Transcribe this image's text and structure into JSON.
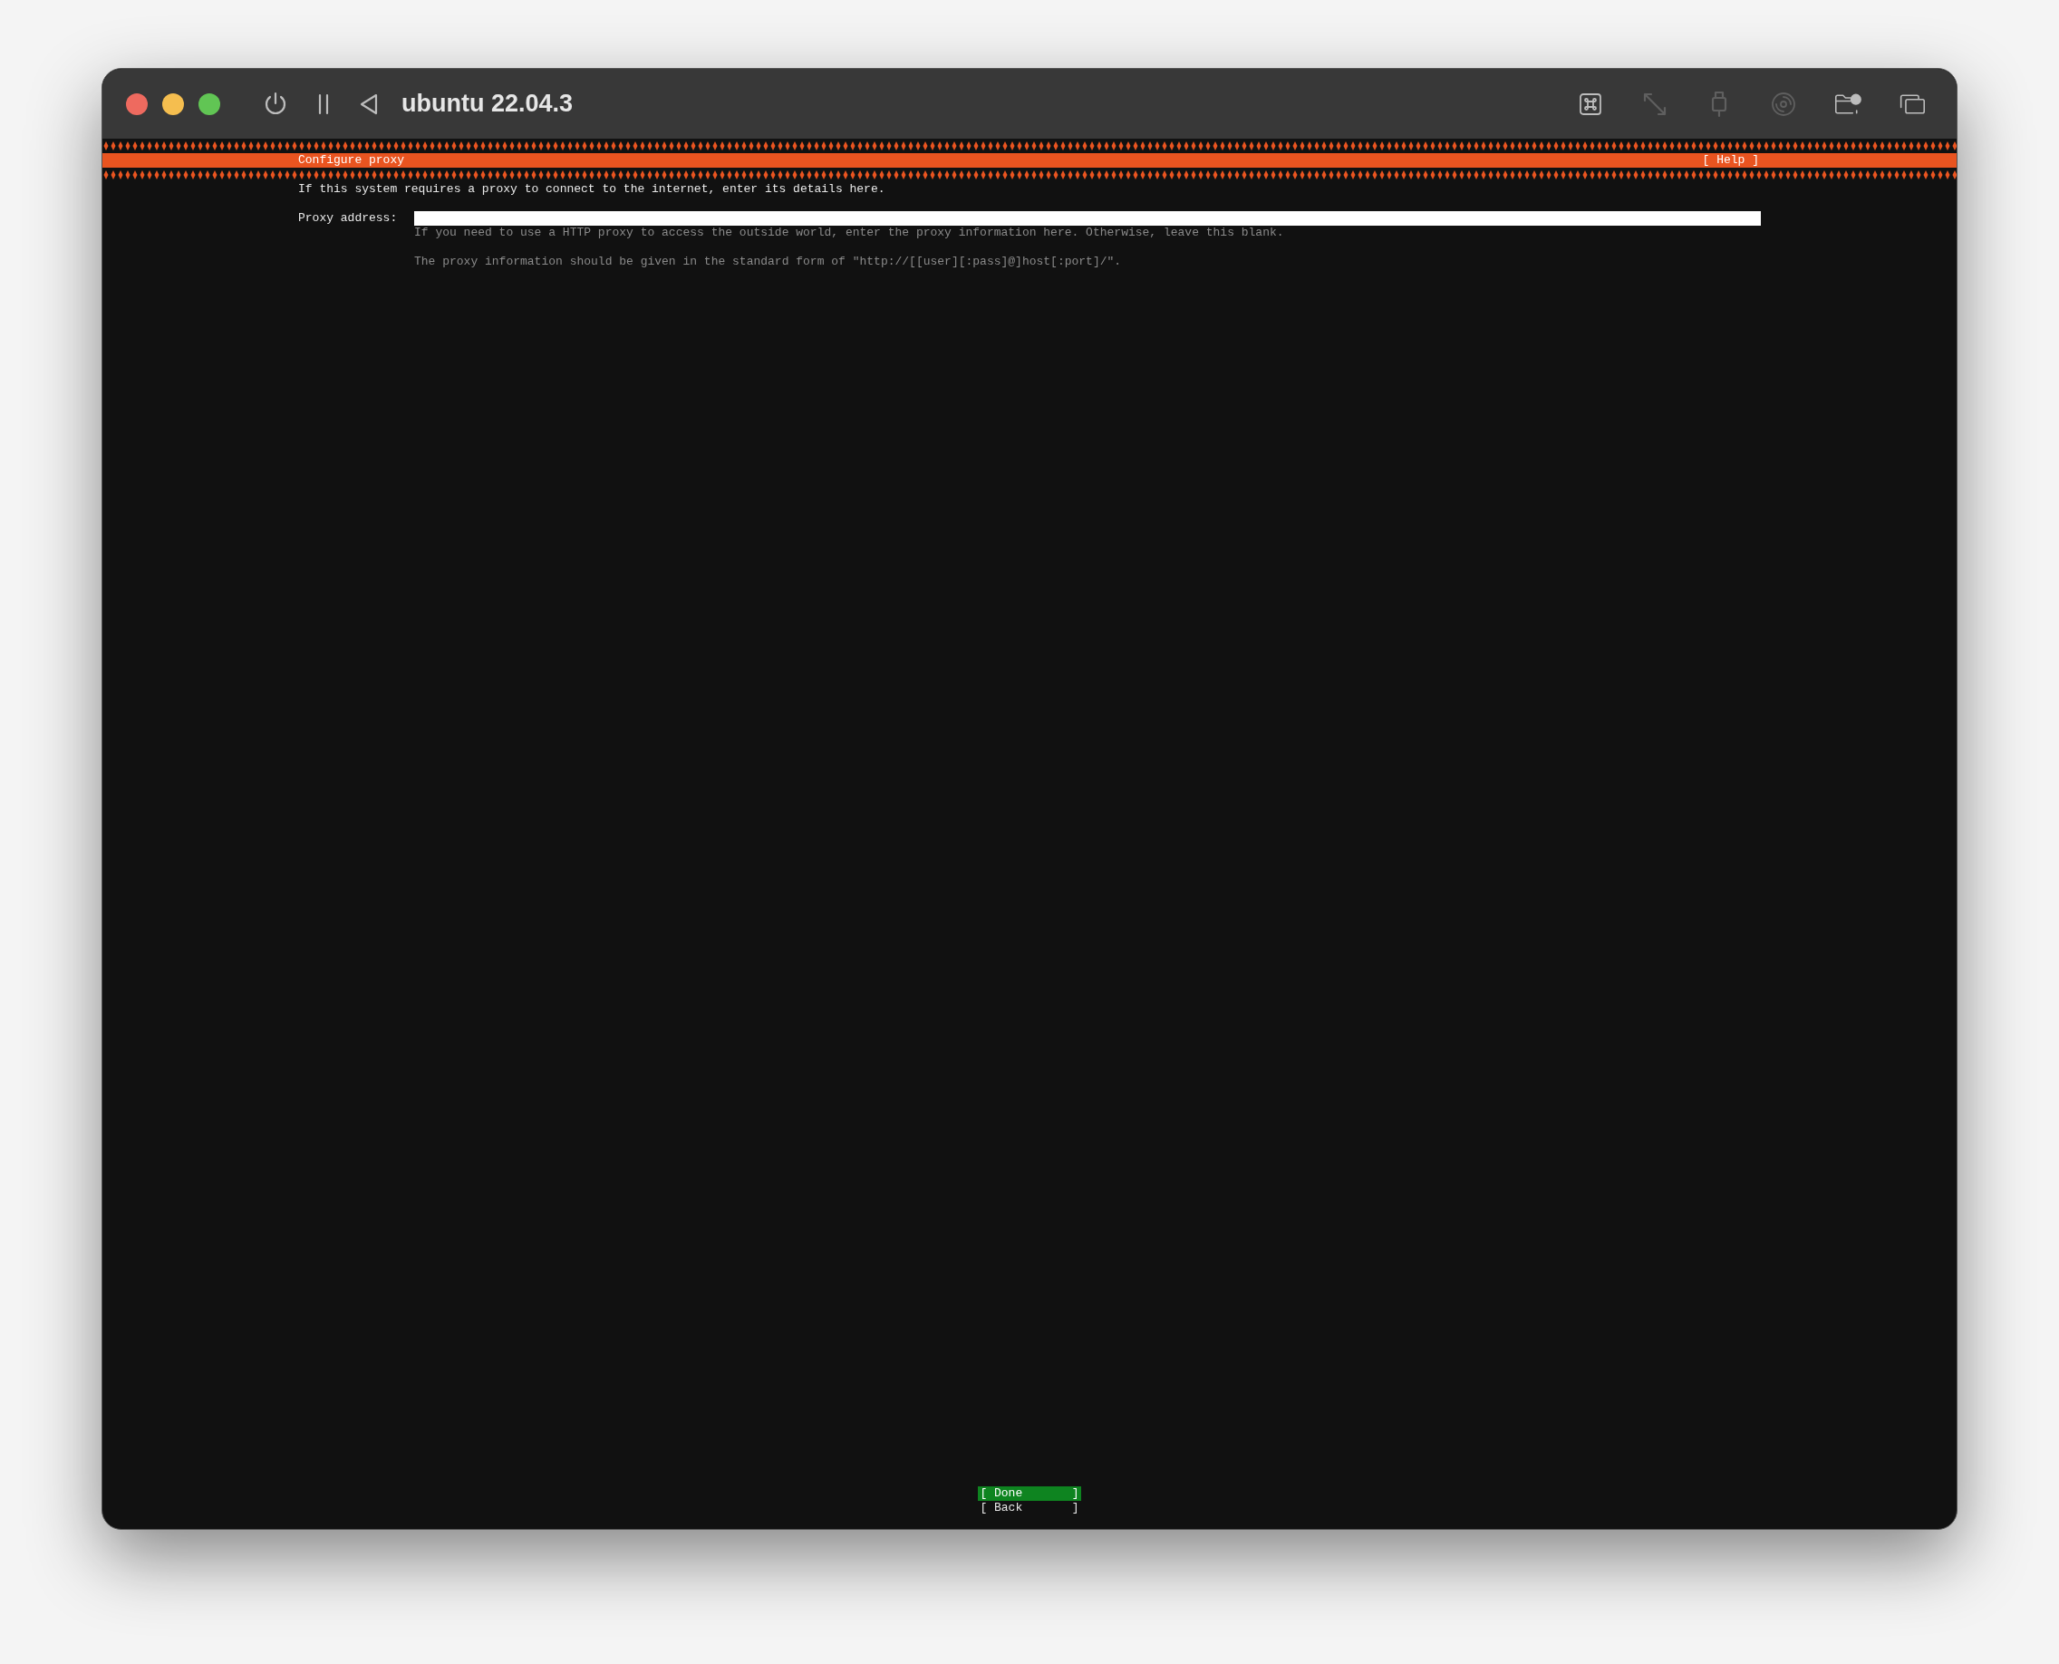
{
  "window": {
    "title": "ubuntu 22.04.3"
  },
  "toolbar_left": [
    {
      "kind": "power",
      "disabled": false
    },
    {
      "kind": "pause",
      "disabled": false
    },
    {
      "kind": "back",
      "disabled": false
    }
  ],
  "toolbar_right": [
    {
      "kind": "command",
      "disabled": false
    },
    {
      "kind": "resize",
      "disabled": true
    },
    {
      "kind": "usb",
      "disabled": true
    },
    {
      "kind": "disc",
      "disabled": true
    },
    {
      "kind": "shared-folder",
      "disabled": false
    },
    {
      "kind": "windows",
      "disabled": false
    }
  ],
  "header": {
    "title": "Configure proxy",
    "help": "[ Help ]"
  },
  "intro": "If this system requires a proxy to connect to the internet, enter its details here.",
  "proxy_field": {
    "label": "Proxy address:"
  },
  "hints": [
    "If you need to use a HTTP proxy to access the outside world, enter the proxy information here. Otherwise, leave this blank.",
    "The proxy information should be given in the standard form of \"http://[[user][:pass]@]host[:port]/\"."
  ],
  "buttons": [
    {
      "label": "[ Done       ]",
      "selected": true
    },
    {
      "label": "[ Back       ]",
      "selected": false
    }
  ]
}
